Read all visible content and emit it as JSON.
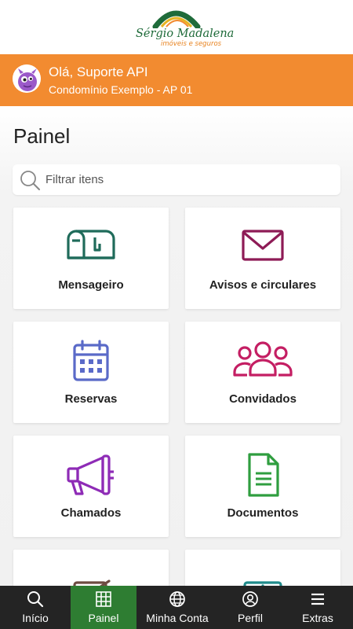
{
  "brand": {
    "name": "Sérgio Madalena",
    "tagline": "imóveis e seguros",
    "colors": {
      "green": "#1f6b3a",
      "orange": "#f28b30",
      "nav_active": "#2e7d32",
      "nav_bg": "#242424"
    }
  },
  "user": {
    "greeting": "Olá, Suporte API",
    "unit": "Condomínio Exemplo - AP 01",
    "avatar_icon": "purple-monster-avatar"
  },
  "page": {
    "title": "Painel"
  },
  "search": {
    "placeholder": "Filtrar itens",
    "icon": "search-icon"
  },
  "cards": [
    {
      "label": "Mensageiro",
      "icon": "mailbox-icon",
      "color": "#1f6b5a"
    },
    {
      "label": "Avisos e circulares",
      "icon": "envelope-icon",
      "color": "#8e1b56"
    },
    {
      "label": "Reservas",
      "icon": "calendar-icon",
      "color": "#5a6ac8"
    },
    {
      "label": "Convidados",
      "icon": "group-icon",
      "color": "#c41e63"
    },
    {
      "label": "Chamados",
      "icon": "megaphone-icon",
      "color": "#8e2bb6"
    },
    {
      "label": "Documentos",
      "icon": "document-icon",
      "color": "#2f9e3f"
    },
    {
      "label": "",
      "icon": "edit-icon",
      "color": "#6d4c41"
    },
    {
      "label": "",
      "icon": "tablet-icon",
      "color": "#1f8a8a"
    }
  ],
  "nav": [
    {
      "label": "Início",
      "icon": "search-icon",
      "active": false
    },
    {
      "label": "Painel",
      "icon": "grid-icon",
      "active": true
    },
    {
      "label": "Minha Conta",
      "icon": "globe-icon",
      "active": false
    },
    {
      "label": "Perfil",
      "icon": "user-icon",
      "active": false
    },
    {
      "label": "Extras",
      "icon": "menu-icon",
      "active": false
    }
  ]
}
